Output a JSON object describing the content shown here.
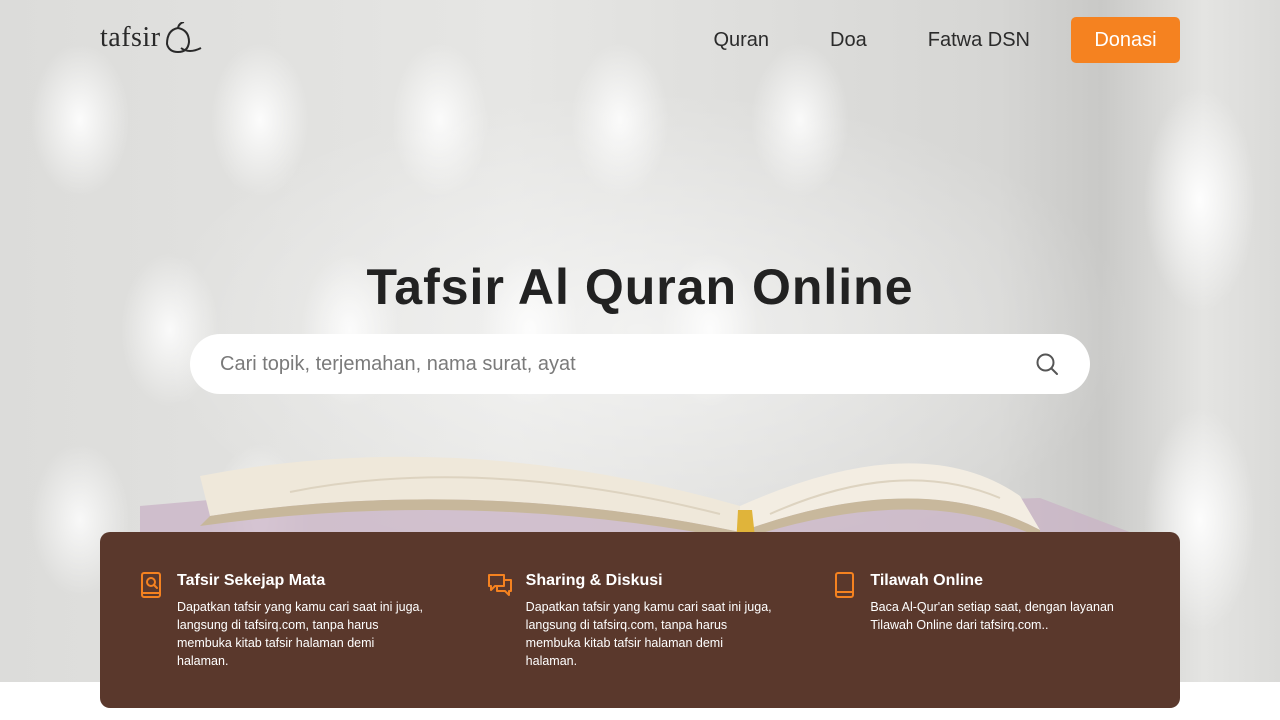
{
  "header": {
    "logo_text": "tafsirQ",
    "nav": [
      {
        "label": "Quran"
      },
      {
        "label": "Doa"
      },
      {
        "label": "Fatwa DSN"
      }
    ],
    "donate_label": "Donasi"
  },
  "hero": {
    "title": "Tafsir Al Quran Online",
    "search": {
      "placeholder": "Cari topik, terjemahan, nama surat, ayat",
      "value": "",
      "icon": "search-icon"
    }
  },
  "features": [
    {
      "icon": "book-search-icon",
      "title": "Tafsir Sekejap Mata",
      "description": "Dapatkan tafsir yang kamu cari saat ini juga, langsung di tafsirq.com, tanpa harus membuka kitab tafsir halaman demi halaman."
    },
    {
      "icon": "chat-bubbles-icon",
      "title": "Sharing & Diskusi",
      "description": "Dapatkan tafsir yang kamu cari saat ini juga, langsung di tafsirq.com, tanpa harus membuka kitab tafsir halaman demi halaman."
    },
    {
      "icon": "book-icon",
      "title": "Tilawah Online",
      "description": "Baca Al-Qur'an setiap saat, dengan layanan Tilawah Online dari tafsirq.com.."
    }
  ],
  "colors": {
    "accent": "#f58220",
    "panel": "#5a382c",
    "title": "#222222"
  }
}
